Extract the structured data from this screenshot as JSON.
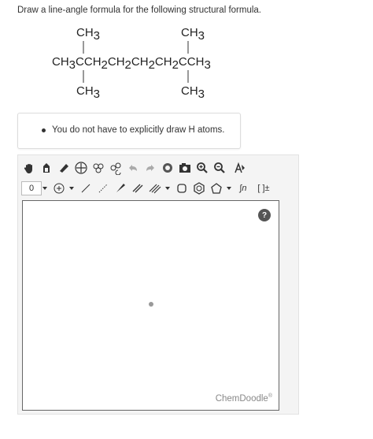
{
  "question": {
    "text": "Draw a line-angle formula for the following structural formula."
  },
  "formula": {
    "top_left": "CH",
    "top_right": "CH",
    "main_chain": "CH",
    "bottom_left": "CH",
    "bottom_right": "CH",
    "sub3": "3",
    "sub2": "2",
    "c": "C"
  },
  "hint": {
    "text": "You do not have to explicitly draw H atoms."
  },
  "toolbar": {
    "charge_value": "0",
    "bracket_label": "[ ]±",
    "ring_label": "∫n"
  },
  "editor": {
    "help_label": "?",
    "watermark": "ChemDoodle",
    "watermark_mark": "®"
  }
}
